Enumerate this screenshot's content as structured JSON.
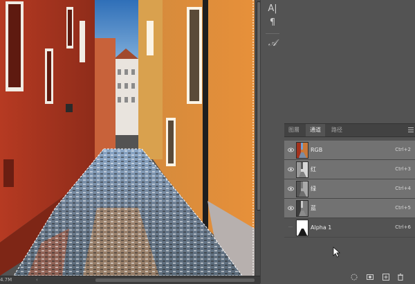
{
  "status": {
    "doc_size": "4.7M",
    "nav_arrow": "‹"
  },
  "toolstrip": {
    "tools": [
      {
        "name": "character-tool-icon",
        "glyph": "A|"
      },
      {
        "name": "paragraph-tool-icon",
        "glyph": "¶"
      },
      {
        "name": "glyph-tool-icon",
        "glyph": "𝒜"
      }
    ]
  },
  "panel": {
    "tabs": [
      {
        "label": "图層",
        "active": false
      },
      {
        "label": "通道",
        "active": true
      },
      {
        "label": "路径",
        "active": false
      }
    ],
    "channels": [
      {
        "name": "RGB",
        "shortcut": "Ctrl+2",
        "visible": true,
        "selected": true,
        "thumb": "rgb"
      },
      {
        "name": "红",
        "shortcut": "Ctrl+3",
        "visible": true,
        "selected": true,
        "thumb": "gray"
      },
      {
        "name": "绿",
        "shortcut": "Ctrl+4",
        "visible": true,
        "selected": true,
        "thumb": "gray"
      },
      {
        "name": "蓝",
        "shortcut": "Ctrl+5",
        "visible": true,
        "selected": true,
        "thumb": "gray"
      },
      {
        "name": "Alpha 1",
        "shortcut": "Ctrl+6",
        "visible": false,
        "selected": false,
        "thumb": "alpha"
      }
    ],
    "bottom_tools": [
      "load-selection-icon",
      "save-selection-icon",
      "new-channel-icon",
      "delete-channel-icon"
    ]
  },
  "colors": {
    "panel_bg": "#535353",
    "selected_row": "#727272",
    "tab_bar": "#424242"
  }
}
